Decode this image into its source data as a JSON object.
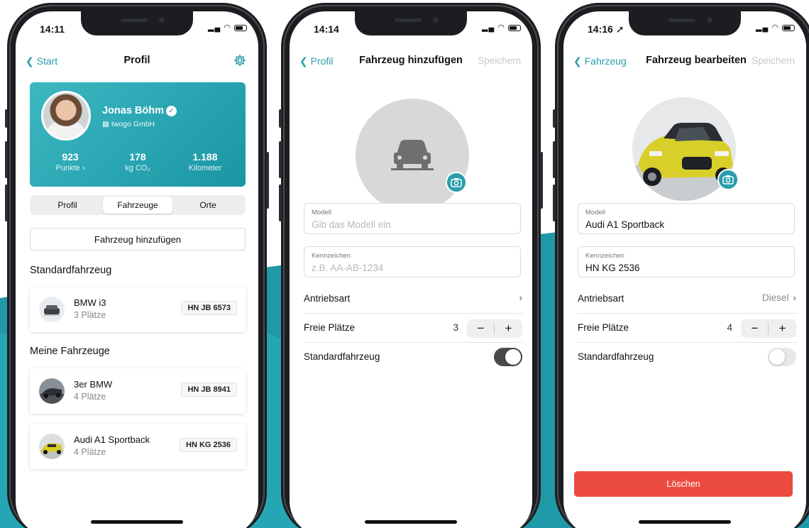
{
  "colors": {
    "teal": "#2a9dab",
    "danger": "#ec4c3f",
    "wave": "#1f99a8"
  },
  "screen1": {
    "status_time": "14:11",
    "nav": {
      "back": "Start",
      "title": "Profil",
      "right_icon": "gear-icon"
    },
    "profile": {
      "name": "Jonas Böhm",
      "company": "twogo GmbH",
      "stats": [
        {
          "value": "923",
          "label": "Punkte ›"
        },
        {
          "value": "178",
          "label": "kg CO₂"
        },
        {
          "value": "1.188",
          "label": "Kilometer"
        }
      ]
    },
    "tabs": [
      "Profil",
      "Fahrzeuge",
      "Orte"
    ],
    "active_tab": "Fahrzeuge",
    "add_button": "Fahrzeug hinzufügen",
    "default_heading": "Standardfahrzeug",
    "default_vehicle": {
      "name": "BMW i3",
      "seats": "3 Plätze",
      "plate": "HN JB 6573"
    },
    "my_heading": "Meine Fahrzeuge",
    "vehicles": [
      {
        "name": "3er BMW",
        "seats": "4 Plätze",
        "plate": "HN JB 8941"
      },
      {
        "name": "Audi A1 Sportback",
        "seats": "4 Plätze",
        "plate": "HN KG 2536"
      }
    ]
  },
  "screen2": {
    "status_time": "14:14",
    "nav": {
      "back": "Profil",
      "title": "Fahrzeug hinzufügen",
      "save": "Speichern"
    },
    "model": {
      "label": "Modell",
      "placeholder": "Gib das Modell ein"
    },
    "plate": {
      "label": "Kennzeichen",
      "placeholder": "z.B. AA-AB-1234"
    },
    "drive_label": "Antriebsart",
    "seats_label": "Freie Plätze",
    "seats_value": "3",
    "default_label": "Standardfahrzeug",
    "default_on": true
  },
  "screen3": {
    "status_time": "14:16",
    "nav": {
      "back": "Fahrzeug",
      "title": "Fahrzeug bearbeiten",
      "save": "Speichern"
    },
    "model": {
      "label": "Modell",
      "value": "Audi A1 Sportback"
    },
    "plate": {
      "label": "Kennzeichen",
      "value": "HN KG 2536"
    },
    "drive_label": "Antriebsart",
    "drive_value": "Diesel",
    "seats_label": "Freie Plätze",
    "seats_value": "4",
    "default_label": "Standardfahrzeug",
    "default_on": false,
    "delete_button": "Löschen"
  }
}
